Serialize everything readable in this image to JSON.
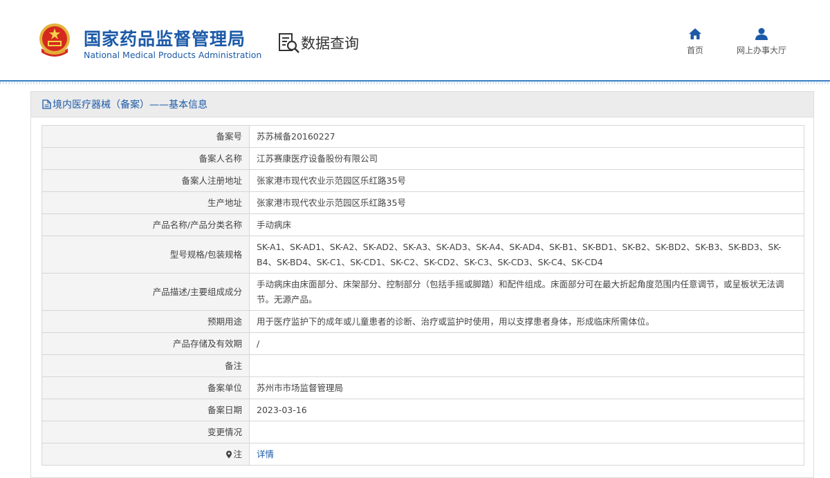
{
  "header": {
    "org_cn": "国家药品监督管理局",
    "org_en": "National Medical Products Administration",
    "brand_title": "数据查询",
    "nav": [
      {
        "label": "首页",
        "icon": "home-icon"
      },
      {
        "label": "网上办事大厅",
        "icon": "user-icon"
      }
    ]
  },
  "panel": {
    "title": "境内医疗器械（备案）——基本信息"
  },
  "rows": [
    {
      "key": "备案号",
      "value": "苏苏械备20160227"
    },
    {
      "key": "备案人名称",
      "value": "江苏赛康医疗设备股份有限公司"
    },
    {
      "key": "备案人注册地址",
      "value": "张家港市现代农业示范园区乐红路35号"
    },
    {
      "key": "生产地址",
      "value": "张家港市现代农业示范园区乐红路35号"
    },
    {
      "key": "产品名称/产品分类名称",
      "value": "手动病床"
    },
    {
      "key": "型号规格/包装规格",
      "value": "SK-A1、SK-AD1、SK-A2、SK-AD2、SK-A3、SK-AD3、SK-A4、SK-AD4、SK-B1、SK-BD1、SK-B2、SK-BD2、SK-B3、SK-BD3、SK-B4、SK-BD4、SK-C1、SK-CD1、SK-C2、SK-CD2、SK-C3、SK-CD3、SK-C4、SK-CD4"
    },
    {
      "key": "产品描述/主要组成成分",
      "value": "手动病床由床面部分、床架部分、控制部分（包括手摇或脚踏）和配件组成。床面部分可在最大折起角度范围内任意调节，或呈板状无法调节。无源产品。"
    },
    {
      "key": "预期用途",
      "value": "用于医疗监护下的成年或儿童患者的诊断、治疗或监护时使用，用以支撑患者身体，形成临床所需体位。"
    },
    {
      "key": "产品存储及有效期",
      "value": "/"
    },
    {
      "key": "备注",
      "value": ""
    },
    {
      "key": "备案单位",
      "value": "苏州市市场监督管理局"
    },
    {
      "key": "备案日期",
      "value": "2023-03-16"
    },
    {
      "key": "变更情况",
      "value": ""
    },
    {
      "key": "注",
      "value": "详情"
    }
  ],
  "colors": {
    "brand_blue": "#1c5aa8",
    "header_line": "#3a7fc4",
    "label_bg": "#f4f4f4",
    "panel_head_bg": "#ececec"
  }
}
